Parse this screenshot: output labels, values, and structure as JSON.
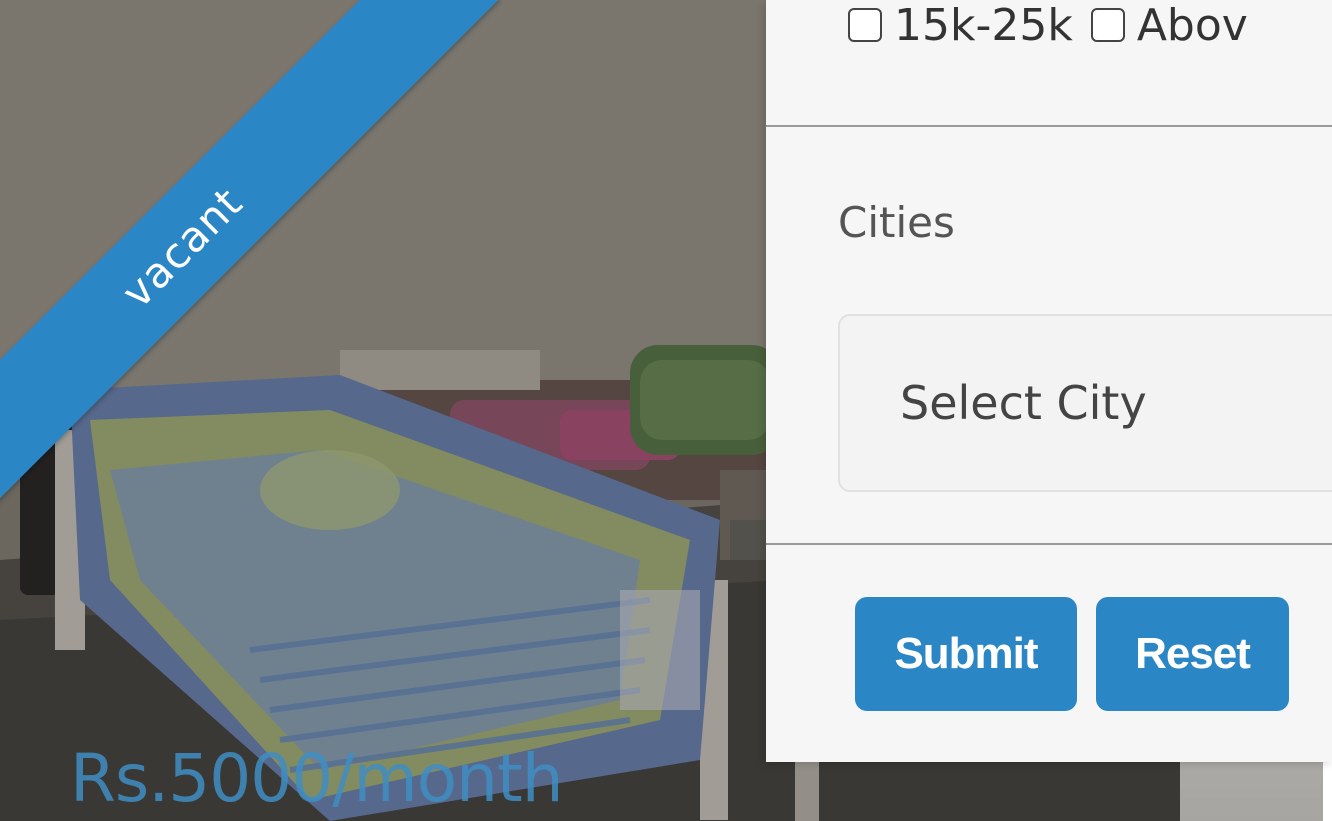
{
  "listing": {
    "status_ribbon": "vacant",
    "price": "Rs.5000/month",
    "photo": "room-with-beds-photo"
  },
  "filters": {
    "budget_options": [
      {
        "label": "15k-25k",
        "checked": false
      },
      {
        "label": "Abov",
        "checked": false
      }
    ],
    "cities": {
      "label": "Cities",
      "selected": "Select City"
    },
    "buttons": {
      "submit": "Submit",
      "reset": "Reset"
    }
  },
  "colors": {
    "accent": "#2b86c5",
    "panel_bg": "#f6f6f6",
    "price_text": "#3f8ec4"
  }
}
